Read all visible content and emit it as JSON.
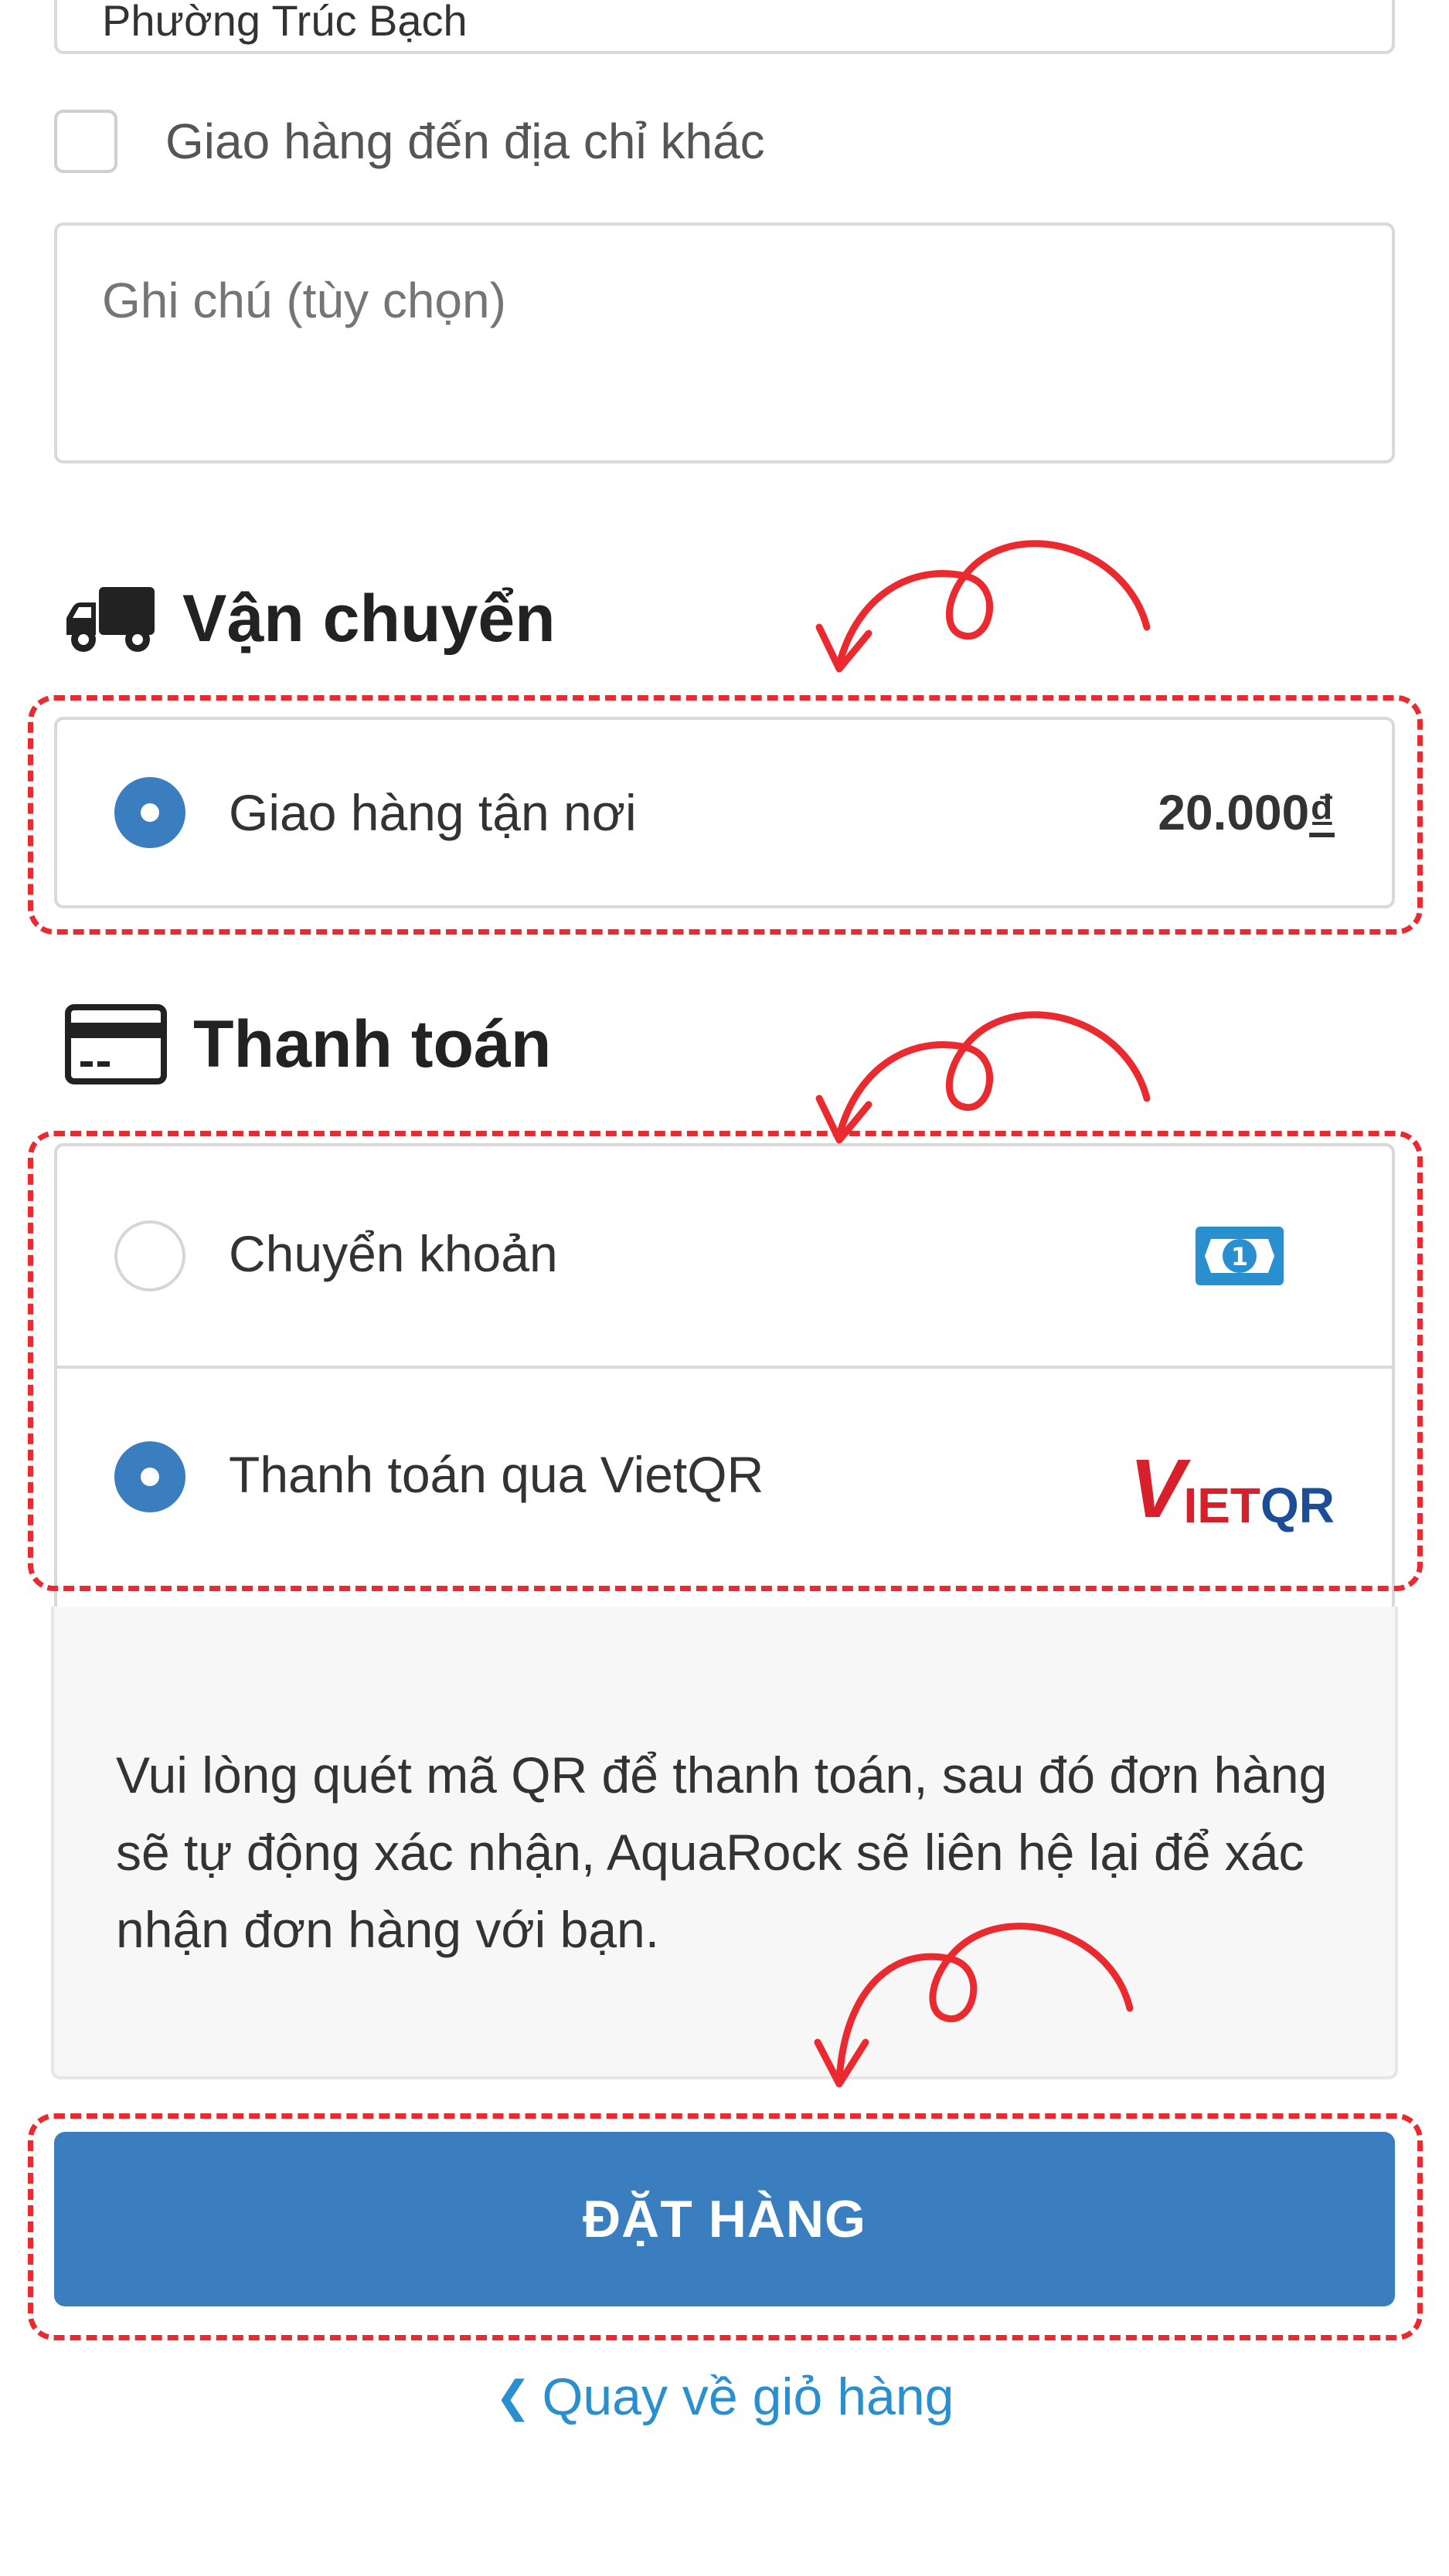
{
  "address": {
    "value": "Phường Trúc Bạch"
  },
  "ship_different": {
    "label": "Giao hàng đến địa chỉ khác",
    "checked": false
  },
  "note": {
    "placeholder": "Ghi chú (tùy chọn)"
  },
  "shipping": {
    "title": "Vận chuyển",
    "icon": "truck-icon",
    "options": [
      {
        "label": "Giao hàng tận nơi",
        "price": "20.000",
        "currency": "₫",
        "selected": true
      }
    ]
  },
  "payment": {
    "title": "Thanh toán",
    "icon": "credit-card-icon",
    "options": [
      {
        "label": "Chuyển khoản",
        "icon": "banknote-icon",
        "selected": false
      },
      {
        "label": "Thanh toán qua VietQR",
        "logo": {
          "v": "V",
          "red": "IET",
          "blue": "QR"
        },
        "selected": true
      }
    ],
    "info": "Vui lòng quét mã QR để thanh toán, sau đó đơn hàng sẽ tự động xác nhận, AquaRock sẽ liên hệ lại để xác nhận đơn hàng với bạn."
  },
  "order_button": {
    "label": "ĐẶT HÀNG"
  },
  "back_link": {
    "chevron": "❮",
    "label": "Quay về giỏ hàng"
  },
  "colors": {
    "primary": "#3a7ebf",
    "link": "#2a8fce",
    "annotation": "#ea2a2f",
    "vietqr_red": "#d7202c",
    "vietqr_blue": "#1b4e97"
  }
}
